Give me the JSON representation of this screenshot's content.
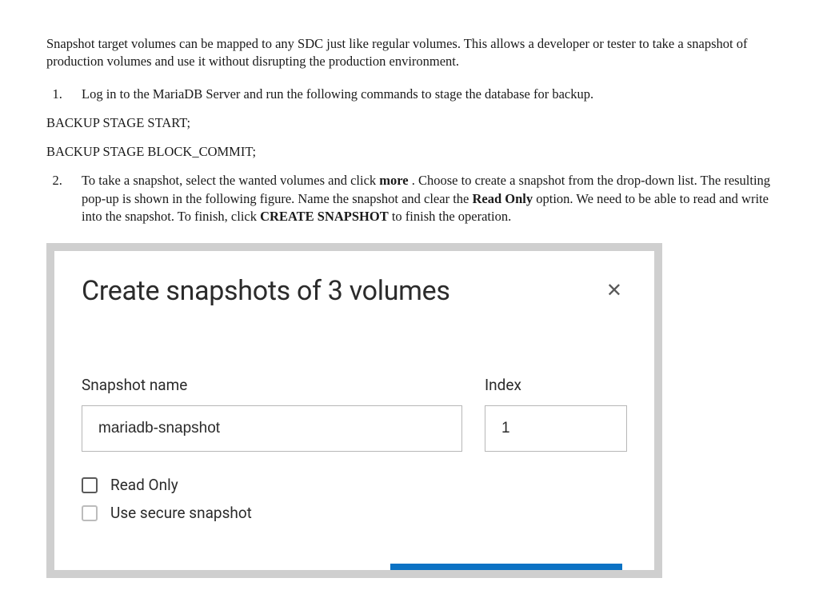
{
  "intro": "Snapshot target volumes can be mapped to any SDC just like regular volumes. This allows a developer or tester to take a snapshot of production volumes and use it without disrupting the production environment.",
  "steps": {
    "s1": "Log in to the MariaDB Server and run the following commands to stage the database for backup.",
    "cmd1": "BACKUP STAGE START;",
    "cmd2": "BACKUP STAGE BLOCK_COMMIT;",
    "s2_a": "To take a snapshot, select the wanted volumes and click ",
    "s2_more": "more",
    "s2_b": " . Choose to create a snapshot from the drop-down list. The resulting pop-up is shown in the following figure. Name the snapshot and clear the ",
    "s2_ro": "Read Only",
    "s2_c": " option. We need to be able to read and write into the snapshot. To finish, click ",
    "s2_create": "CREATE SNAPSHOT",
    "s2_d": " to finish the operation."
  },
  "dialog": {
    "title": "Create snapshots of 3 volumes",
    "close_glyph": "✕",
    "name_label": "Snapshot name",
    "name_value": "mariadb-snapshot",
    "index_label": "Index",
    "index_value": "1",
    "read_only_label": "Read Only",
    "secure_label": "Use secure snapshot"
  }
}
